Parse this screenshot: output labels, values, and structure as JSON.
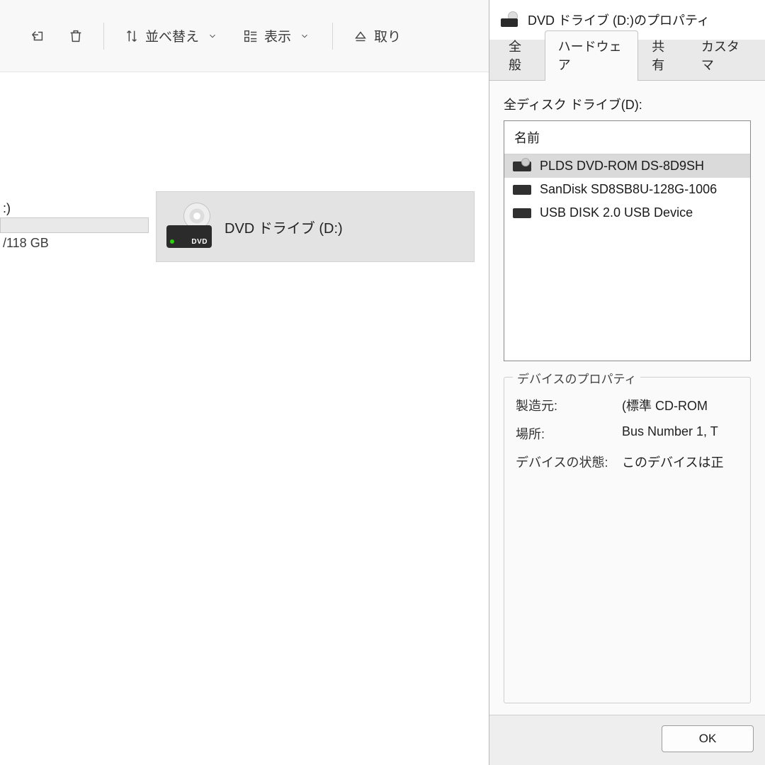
{
  "explorer": {
    "toolbar": {
      "sort_label": "並べ替え",
      "view_label": "表示",
      "eject_label": "取り"
    },
    "drive_c": {
      "label": ":)",
      "capacity_text": "/118 GB"
    },
    "dvd_tile": {
      "label": "DVD ドライブ (D:)",
      "badge": "DVD"
    }
  },
  "dialog": {
    "title": "DVD ドライブ (D:)のプロパティ",
    "tabs": {
      "general": "全般",
      "hardware": "ハードウェア",
      "sharing": "共有",
      "customize": "カスタマ"
    },
    "all_drives_label": "全ディスク ドライブ(D):",
    "list_header": "名前",
    "devices": [
      "PLDS DVD-ROM DS-8D9SH",
      "SanDisk SD8SB8U-128G-1006",
      "USB DISK 2.0 USB Device"
    ],
    "properties_group_title": "デバイスのプロパティ",
    "properties": {
      "manufacturer_label": "製造元:",
      "manufacturer_value": "(標準 CD-ROM ",
      "location_label": "場所:",
      "location_value": "Bus Number 1, T",
      "status_label": "デバイスの状態:",
      "status_value": "このデバイスは正"
    },
    "ok_button": "OK"
  }
}
